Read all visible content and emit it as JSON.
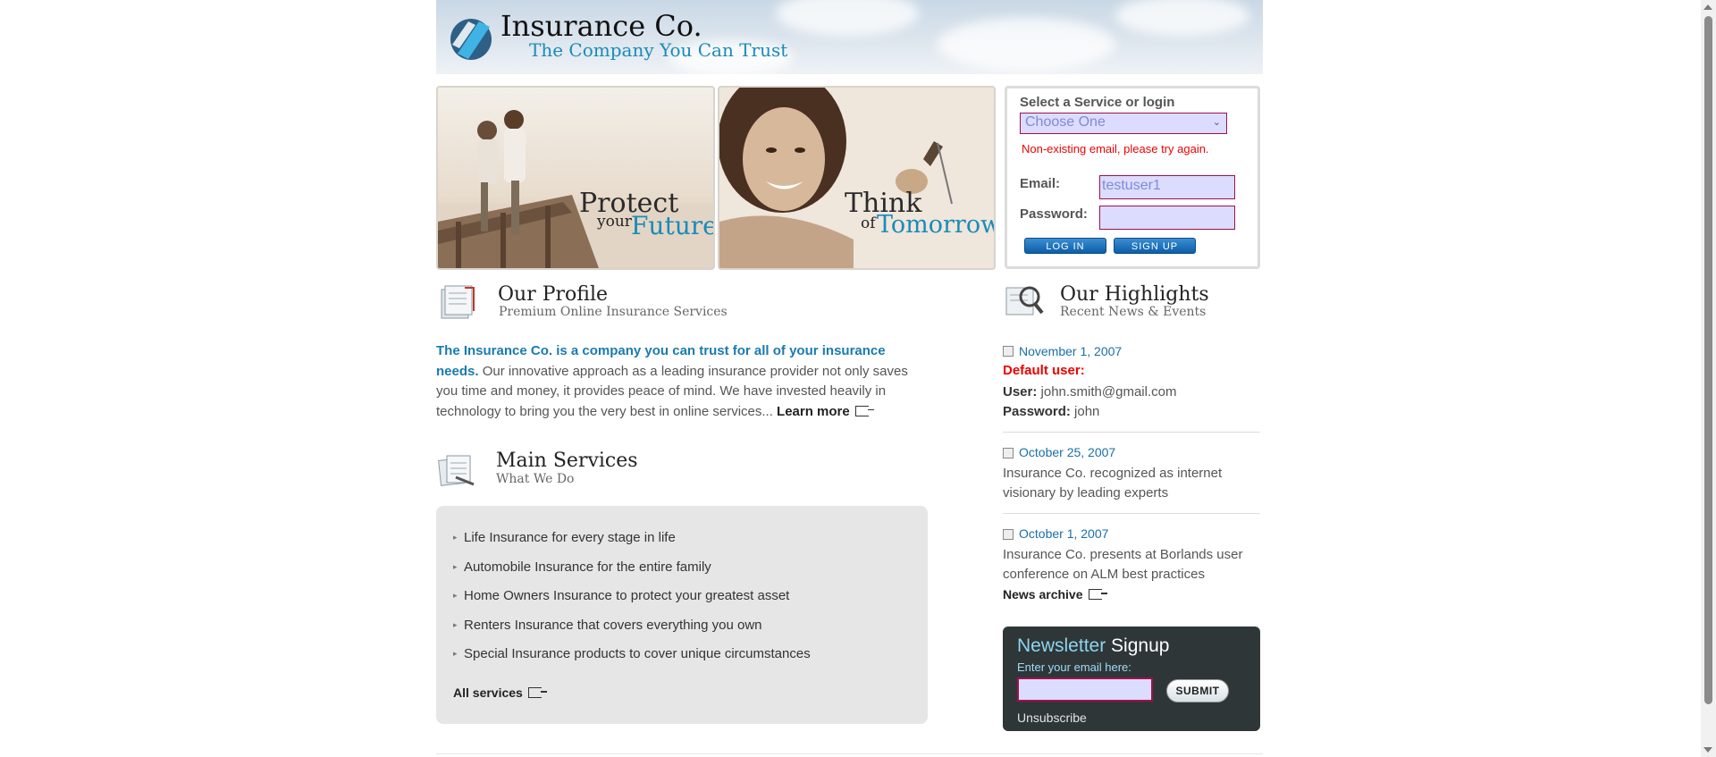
{
  "header": {
    "brand": "Insurance Co.",
    "tagline": "The Company You Can Trust"
  },
  "banners": [
    {
      "line1": "Protect",
      "line2_small": "your",
      "line2_accent": "Future"
    },
    {
      "line1": "Think",
      "line2_small": "of",
      "line2_accent": "Tomorrow"
    }
  ],
  "login": {
    "title": "Select a Service or login",
    "select_value": "Choose One",
    "error": "Non-existing email, please try again.",
    "email_label": "Email:",
    "email_value": "testuser1",
    "password_label": "Password:",
    "password_value": "",
    "login_button": "LOG IN",
    "signup_button": "SIGN UP"
  },
  "profile": {
    "title": "Our Profile",
    "subtitle": "Premium Online Insurance Services",
    "lead": "The Insurance Co. is a company you can trust for all of your insurance needs.",
    "body": " Our innovative approach as a leading insurance provider not only saves you time and money, it provides peace of mind. We have invested heavily in technology to bring you the very best in online services... ",
    "learn_more": "Learn more"
  },
  "services": {
    "title": "Main Services",
    "subtitle": "What We Do",
    "items": [
      "Life Insurance for every stage in life",
      "Automobile Insurance for the entire family",
      "Home Owners Insurance to protect your greatest asset",
      "Renters Insurance that covers everything you own",
      "Special Insurance products to cover unique circumstances"
    ],
    "all_link": "All services"
  },
  "highlights": {
    "title": "Our Highlights",
    "subtitle": "Recent News & Events",
    "news": [
      {
        "date": "November 1, 2007",
        "default_user_label": "Default user:",
        "user_label": "User:",
        "user_value": " john.smith@gmail.com",
        "password_label": "Password:",
        "password_value": " john"
      },
      {
        "date": "October 25, 2007",
        "text": "Insurance Co. recognized as internet visionary by leading experts"
      },
      {
        "date": "October 1, 2007",
        "text": "Insurance Co. presents at Borlands user conference on ALM best practices"
      }
    ],
    "archive_link": "News archive"
  },
  "newsletter": {
    "title_first": "Newsletter",
    "title_second": " Signup",
    "label": "Enter your email here:",
    "submit": "SUBMIT",
    "unsubscribe": "Unsubscribe"
  },
  "colors": {
    "accent_blue": "#1a8bb8",
    "error_red": "#e00000",
    "newsletter_bg": "#2e3638"
  }
}
